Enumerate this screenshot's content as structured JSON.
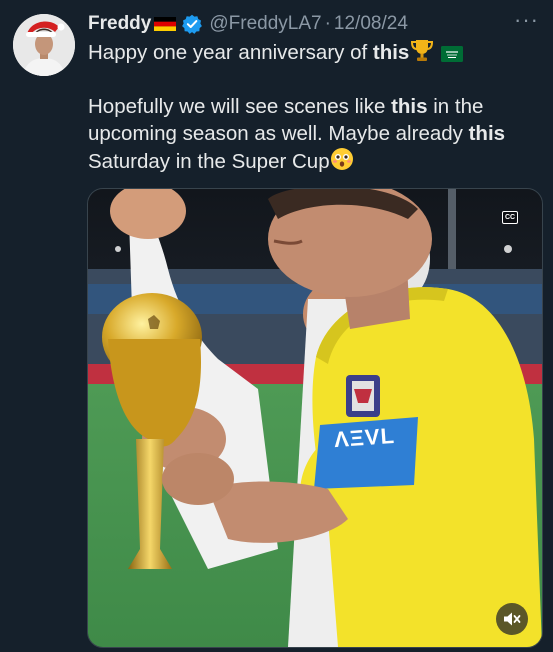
{
  "tweet": {
    "author_name": "Freddy",
    "handle": "@FreddyLA7",
    "separator": "·",
    "date": "12/08/24",
    "more_label": "···",
    "line1_pre": "Happy one year anniversary of ",
    "line1_bold": "this",
    "para2_a": "Hopefully we will see scenes like ",
    "para2_bold1": "this",
    "para2_b": " in the upcoming season as well. Maybe already ",
    "para2_bold2": "this",
    "para2_c": " Saturday in the Super Cup",
    "emojis": [
      "german-flag",
      "trophy",
      "saudi-flag",
      "flushed-face"
    ]
  },
  "media": {
    "cc_label": "CC",
    "armband_text": "ΛΞVL",
    "icons": [
      "closed-captions-icon",
      "volume-muted-icon"
    ]
  },
  "colors": {
    "background": "#15202b",
    "text": "#e7e9ea",
    "muted": "#8b98a5",
    "verified": "#1d9bf0",
    "jersey": "#f3e22a",
    "armband": "#2f7fd4"
  }
}
